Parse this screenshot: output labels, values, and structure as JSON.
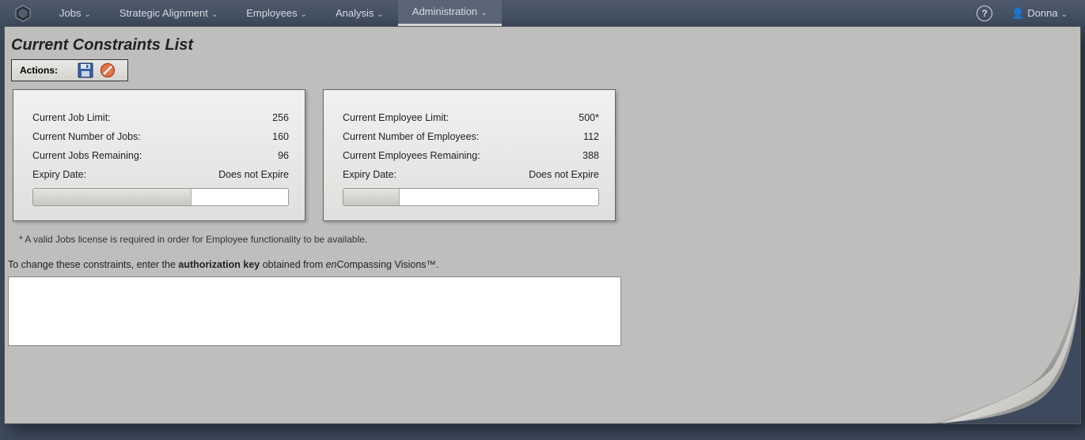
{
  "nav": {
    "items": [
      {
        "label": "Jobs"
      },
      {
        "label": "Strategic Alignment"
      },
      {
        "label": "Employees"
      },
      {
        "label": "Analysis"
      },
      {
        "label": "Administration",
        "active": true
      }
    ],
    "user": "Donna"
  },
  "page": {
    "title": "Current Constraints List",
    "actions_label": "Actions:"
  },
  "jobs_panel": {
    "r1_label": "Current Job Limit:",
    "r1_val": "256",
    "r2_label": "Current Number of Jobs:",
    "r2_val": "160",
    "r3_label": "Current Jobs Remaining:",
    "r3_val": "96",
    "r4_label": "Expiry Date:",
    "r4_val": "Does not Expire",
    "progress_pct": 62
  },
  "emp_panel": {
    "r1_label": "Current Employee Limit:",
    "r1_val": "500*",
    "r2_label": "Current Number of Employees:",
    "r2_val": "112",
    "r3_label": "Current Employees Remaining:",
    "r3_val": "388",
    "r4_label": "Expiry Date:",
    "r4_val": "Does not Expire",
    "progress_pct": 22
  },
  "footnote": "* A valid Jobs license is required in order for Employee functionality to be available.",
  "instruction": {
    "pre": "To change these constraints, enter the ",
    "bold": "authorization key",
    "mid": " obtained from ",
    "italic": "en",
    "post": "Compassing Visions™."
  }
}
